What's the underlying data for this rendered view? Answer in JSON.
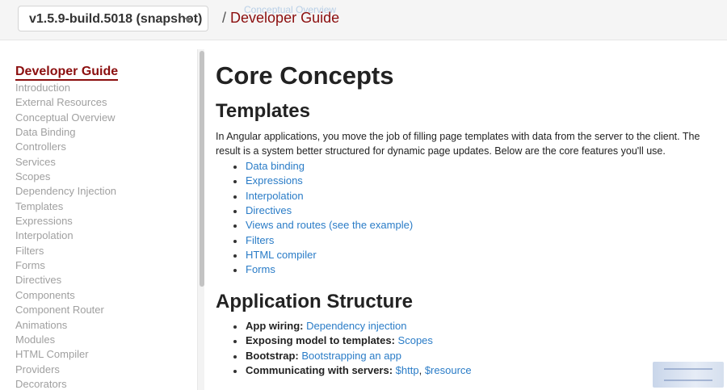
{
  "header": {
    "version_value": "v1.5.9-build.5018 (snapshot)",
    "ghost_link": "Conceptual Overview",
    "breadcrumb_separator": "/",
    "breadcrumb_current": "Developer Guide"
  },
  "sidebar": {
    "heading": "Developer Guide",
    "items": [
      {
        "label": "Introduction"
      },
      {
        "label": "External Resources"
      },
      {
        "label": "Conceptual Overview"
      },
      {
        "label": "Data Binding"
      },
      {
        "label": "Controllers"
      },
      {
        "label": "Services"
      },
      {
        "label": "Scopes"
      },
      {
        "label": "Dependency Injection"
      },
      {
        "label": "Templates"
      },
      {
        "label": "Expressions"
      },
      {
        "label": "Interpolation"
      },
      {
        "label": "Filters"
      },
      {
        "label": "Forms"
      },
      {
        "label": "Directives"
      },
      {
        "label": "Components"
      },
      {
        "label": "Component Router"
      },
      {
        "label": "Animations"
      },
      {
        "label": "Modules"
      },
      {
        "label": "HTML Compiler"
      },
      {
        "label": "Providers"
      },
      {
        "label": "Decorators"
      }
    ]
  },
  "main": {
    "title": "Core Concepts",
    "templates": {
      "heading": "Templates",
      "intro": "In Angular applications, you move the job of filling page templates with data from the server to the client. The result is a system better structured for dynamic page updates. Below are the core features you'll use.",
      "links": [
        {
          "label": "Data binding"
        },
        {
          "label": "Expressions"
        },
        {
          "label": "Interpolation"
        },
        {
          "label": "Directives"
        },
        {
          "label": "Views and routes (see the example)"
        },
        {
          "label": "Filters"
        },
        {
          "label": "HTML compiler"
        },
        {
          "label": "Forms"
        }
      ]
    },
    "structure": {
      "heading": "Application Structure",
      "items": [
        {
          "term": "App wiring:",
          "links": [
            "Dependency injection"
          ]
        },
        {
          "term": "Exposing model to templates:",
          "links": [
            "Scopes"
          ]
        },
        {
          "term": "Bootstrap:",
          "links": [
            "Bootstrapping an app"
          ]
        },
        {
          "term": "Communicating with servers:",
          "links": [
            "$http",
            "$resource"
          ],
          "separator": ", "
        }
      ]
    }
  },
  "colors": {
    "accent": "#8b0e0e",
    "link": "#2a7cc7",
    "nav_text": "#a0a0a0"
  }
}
